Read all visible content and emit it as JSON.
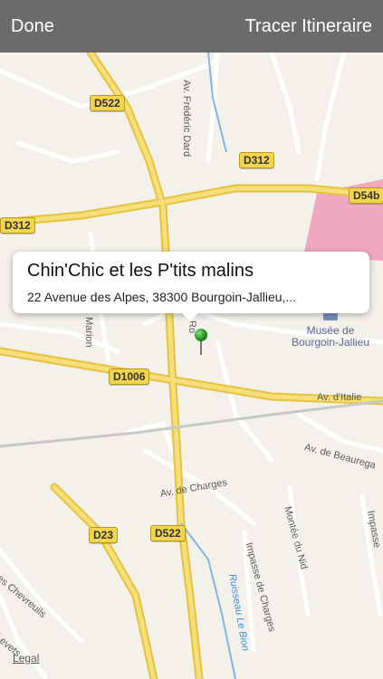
{
  "nav": {
    "done_label": "Done",
    "route_label": "Tracer Itineraire"
  },
  "callout": {
    "title": "Chin'Chic et les P'tits malins",
    "address": "22 Avenue des Alpes, 38300 Bourgoin-Jallieu,..."
  },
  "map": {
    "road_labels": [
      "D522",
      "D312",
      "D54b",
      "D312",
      "D1006",
      "D23",
      "D522"
    ],
    "streets": [
      "Av. Frédéric Dard",
      "Av. d'Italie",
      "Av. de Beaurega",
      "Av. de Charges",
      "Montée du Nid",
      "Impasse de Charges",
      "Impasse",
      "es Chevreuils",
      "Levets",
      "Marion",
      "Ro"
    ],
    "waterway": "Ruisseau Le Bion",
    "museum": {
      "line1": "Musée de",
      "line2": "Bourgoin-Jallieu"
    },
    "legal_label": "Legal"
  },
  "colors": {
    "navbar": "#6b6b6b",
    "map_bg": "#f4f1ea",
    "road_major": "#f2d54e",
    "park_pink": "#f0a8c0",
    "pin": "#1c8a1c"
  }
}
